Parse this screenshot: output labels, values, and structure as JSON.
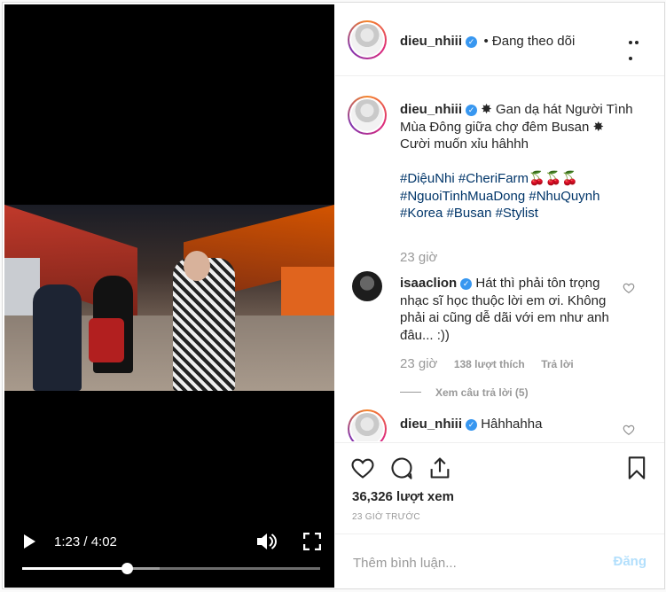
{
  "video": {
    "time_display": "1:23 / 4:02",
    "progress_fraction": 0.35,
    "buffered_fraction": 0.46
  },
  "header": {
    "username": "dieu_nhiii",
    "follow_status": "• Đang theo dõi"
  },
  "caption": {
    "username": "dieu_nhiii",
    "text": "Gan dạ hát Người Tình Mùa Đông giữa chợ đêm Busan",
    "text2": "Cười muốn xỉu hâhhh",
    "hashtags_line1": "#DiệuNhi #CheriFarm🍒🍒🍒",
    "hashtags_line2": "#NguoiTinhMuaDong #NhuQuynh",
    "hashtags_line3": "#Korea #Busan #Stylist",
    "time": "23 giờ"
  },
  "comments": [
    {
      "username": "isaaclion",
      "text": "Hát thì phải tôn trọng nhạc sĩ học thuộc lời em ơi. Không phải ai cũng dễ dãi với em như anh đâu... :))",
      "time": "23 giờ",
      "likes": "138 lượt thích",
      "reply_label": "Trả lời",
      "view_replies": "Xem câu trả lời (5)"
    },
    {
      "username": "dieu_nhiii",
      "text": "Hâhhahha"
    }
  ],
  "stats": {
    "views": "36,326 lượt xem",
    "posted_ago": "23 GIỜ TRƯỚC"
  },
  "add_comment": {
    "placeholder": "Thêm bình luận...",
    "post_label": "Đăng"
  },
  "colors": {
    "verified": "#3897f0",
    "hashtag": "#003569",
    "post_button_disabled": "#b2dffc"
  }
}
